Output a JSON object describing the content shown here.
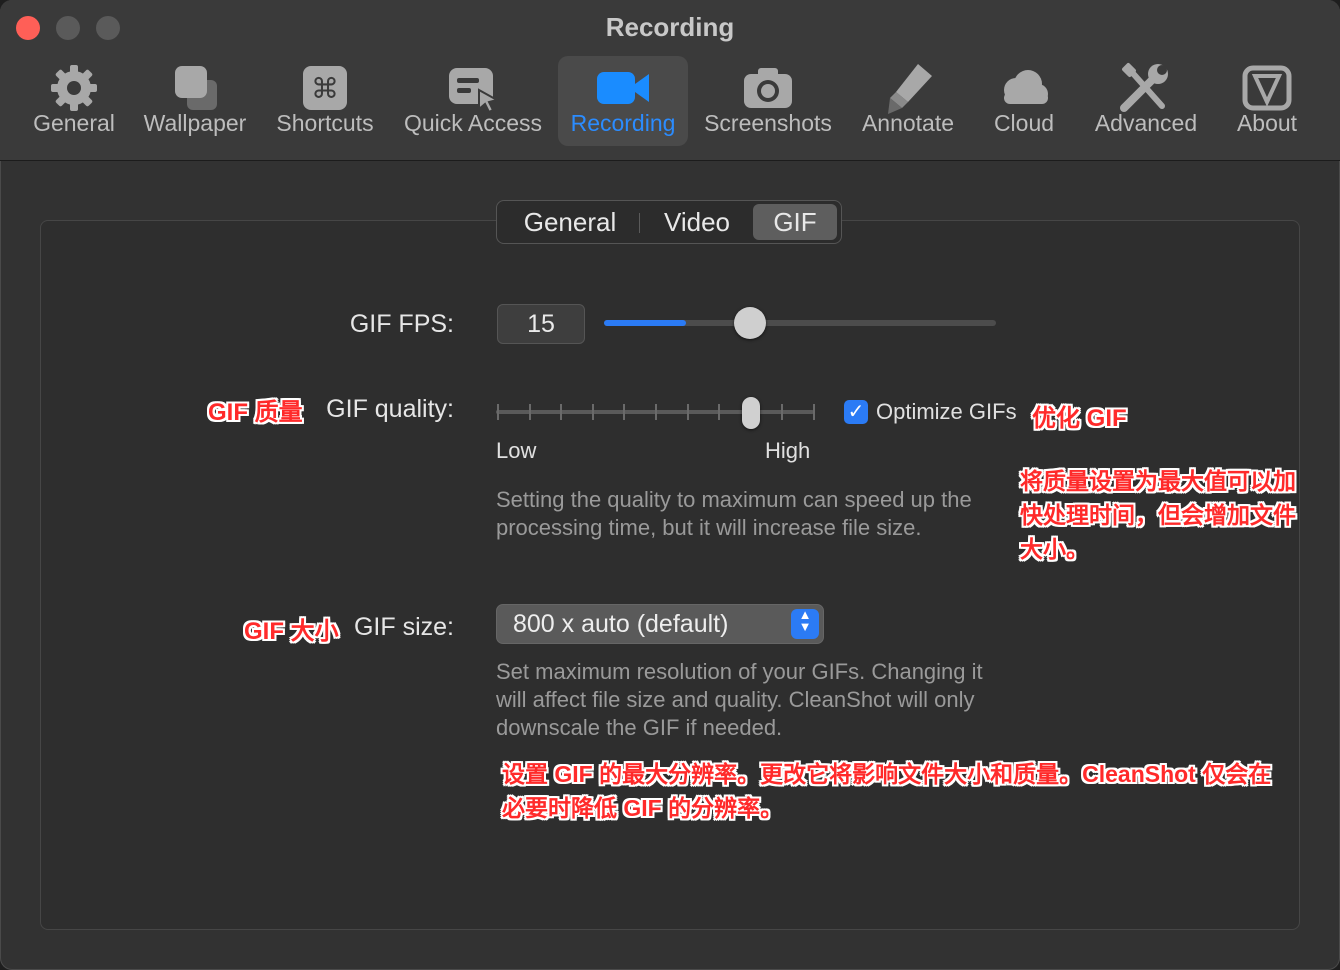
{
  "window": {
    "title": "Recording"
  },
  "toolbar": {
    "tabs": [
      {
        "label": "General",
        "icon": "gear-icon"
      },
      {
        "label": "Wallpaper",
        "icon": "wallpaper-icon"
      },
      {
        "label": "Shortcuts",
        "icon": "command-key-icon"
      },
      {
        "label": "Quick Access",
        "icon": "quick-access-icon"
      },
      {
        "label": "Recording",
        "icon": "video-camera-icon",
        "active": true
      },
      {
        "label": "Screenshots",
        "icon": "camera-icon"
      },
      {
        "label": "Annotate",
        "icon": "highlighter-icon"
      },
      {
        "label": "Cloud",
        "icon": "cloud-icon"
      },
      {
        "label": "Advanced",
        "icon": "tools-icon"
      },
      {
        "label": "About",
        "icon": "about-icon"
      }
    ]
  },
  "segmented": {
    "items": [
      "General",
      "Video",
      "GIF"
    ],
    "selected": "GIF"
  },
  "gif_fps": {
    "label": "GIF FPS:",
    "value": "15",
    "slider_fraction": 0.21
  },
  "gif_quality": {
    "label": "GIF quality:",
    "annotation": "GIF 质量",
    "low_label": "Low",
    "high_label": "High",
    "steps": 11,
    "selected_step": 9,
    "help": "Setting the quality to maximum can speed up the processing time, but it will increase file size.",
    "optimize_label": "Optimize GIFs",
    "optimize_checked": true,
    "optimize_annotation": "优化 GIF",
    "help_annotation_lines": [
      "将质量设置为最大值可以加",
      "快处理时间，但会增加文件",
      "大小。"
    ]
  },
  "gif_size": {
    "label": "GIF size:",
    "annotation": "GIF 大小",
    "value": "800 x auto (default)",
    "help_lines": [
      "Set maximum resolution of your GIFs. Changing it",
      "will affect file size and quality. CleanShot will only",
      "downscale the GIF if needed."
    ],
    "help_annotation_lines": [
      "设置 GIF 的最大分辨率。更改它将影响文件大小和质量。CleanShot 仅会在",
      "必要时降低 GIF 的分辨率。"
    ]
  },
  "colors": {
    "accent": "#2b7bf5",
    "annotation": "#ff2a2a",
    "close": "#ff5f57"
  }
}
